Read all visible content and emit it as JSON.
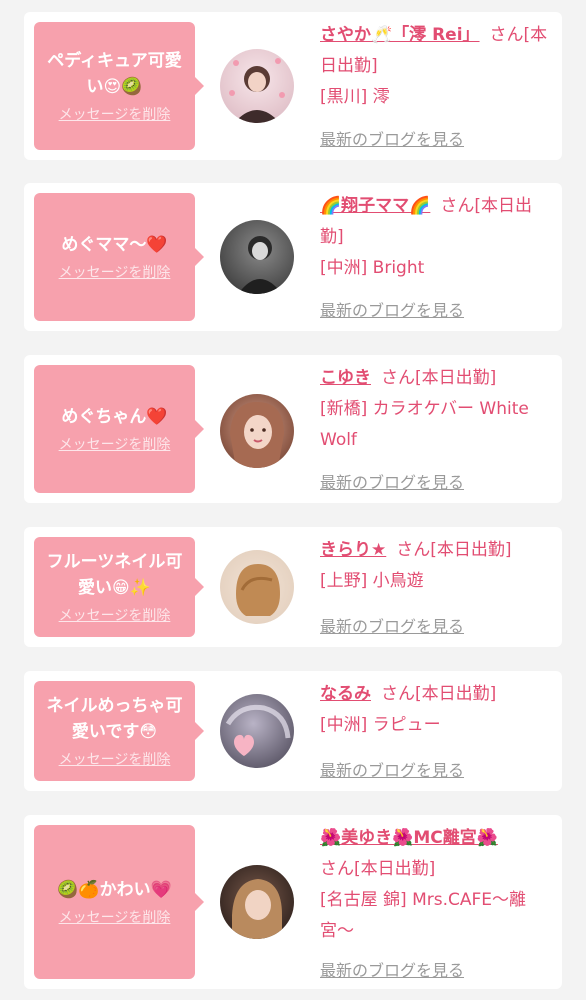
{
  "delete_label": "メッセージを削除",
  "san_label": "さん[本日出勤]",
  "blog_label": "最新のブログを見る",
  "colors": {
    "accent": "#e24d72",
    "bubble": "#f7a1ad",
    "card": "#ffffff",
    "background": "#f3f3f3",
    "link_gray": "#9a9a9a"
  },
  "messages": [
    {
      "message": "ペディキュア可愛い😍🥝",
      "name": "さやか🥂「澪 Rei」",
      "shop": "[黒川] 澪"
    },
    {
      "message": "めぐママ〜❤️",
      "name": "🌈翔子ママ🌈",
      "shop": "[中洲] Bright"
    },
    {
      "message": "めぐちゃん❤️",
      "name": "こゆき",
      "shop": "[新橋] カラオケバー White Wolf"
    },
    {
      "message": "フルーツネイル可愛い😁✨",
      "name": "きらり★",
      "shop": "[上野] 小鳥遊"
    },
    {
      "message": "ネイルめっちゃ可愛いです😳",
      "name": "なるみ",
      "shop": "[中洲] ラピュー"
    },
    {
      "message": "🥝🍊かわい💗",
      "name": "🌺美ゆき🌺MC離宮🌺",
      "shop": "[名古屋 錦] Mrs.CAFE〜離宮〜"
    }
  ]
}
